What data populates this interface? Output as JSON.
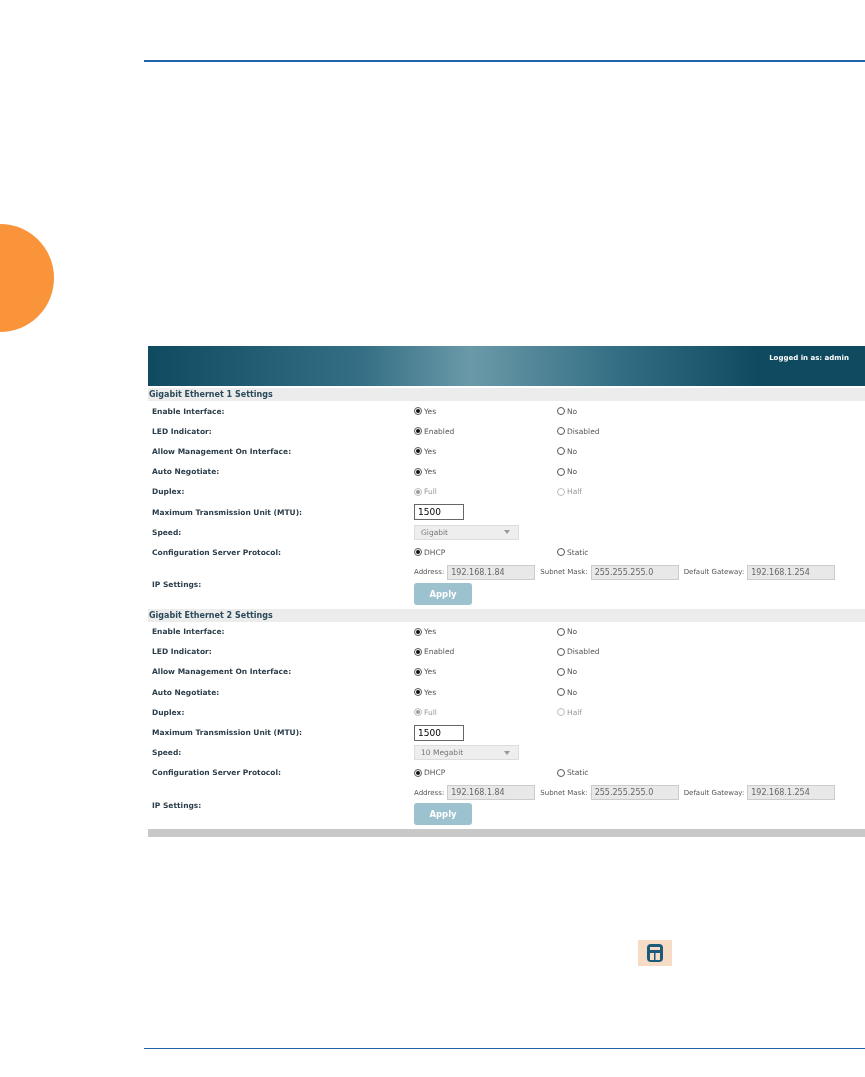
{
  "header": {
    "login_text": "Logged in as: admin"
  },
  "sections": [
    {
      "title": "Gigabit Ethernet 1 Settings",
      "rows": [
        {
          "kind": "radio",
          "label": "Enable Interface:",
          "options": [
            {
              "label": "Yes",
              "selected": true,
              "disabled": false
            },
            {
              "label": "No",
              "selected": false,
              "disabled": false
            }
          ]
        },
        {
          "kind": "radio",
          "label": "LED Indicator:",
          "options": [
            {
              "label": "Enabled",
              "selected": true,
              "disabled": false
            },
            {
              "label": "Disabled",
              "selected": false,
              "disabled": false
            }
          ]
        },
        {
          "kind": "radio",
          "label": "Allow Management On Interface:",
          "options": [
            {
              "label": "Yes",
              "selected": true,
              "disabled": false
            },
            {
              "label": "No",
              "selected": false,
              "disabled": false
            }
          ]
        },
        {
          "kind": "radio",
          "label": "Auto Negotiate:",
          "options": [
            {
              "label": "Yes",
              "selected": true,
              "disabled": false
            },
            {
              "label": "No",
              "selected": false,
              "disabled": false
            }
          ]
        },
        {
          "kind": "radio",
          "label": "Duplex:",
          "options": [
            {
              "label": "Full",
              "selected": true,
              "disabled": true
            },
            {
              "label": "Half",
              "selected": false,
              "disabled": true
            }
          ]
        },
        {
          "kind": "input",
          "label": "Maximum Transmission Unit (MTU):",
          "value": "1500"
        },
        {
          "kind": "select",
          "label": "Speed:",
          "value": "Gigabit"
        },
        {
          "kind": "radio",
          "label": "Configuration Server Protocol:",
          "options": [
            {
              "label": "DHCP",
              "selected": true,
              "disabled": false
            },
            {
              "label": "Static",
              "selected": false,
              "disabled": false
            }
          ]
        },
        {
          "kind": "ip",
          "label": "IP Settings:",
          "fields": [
            {
              "label": "Address:",
              "value": "192.168.1.84"
            },
            {
              "label": "Subnet Mask:",
              "value": "255.255.255.0"
            },
            {
              "label": "Default Gateway:",
              "value": "192.168.1.254"
            }
          ],
          "button": "Apply"
        }
      ]
    },
    {
      "title": "Gigabit Ethernet 2 Settings",
      "rows": [
        {
          "kind": "radio",
          "label": "Enable Interface:",
          "options": [
            {
              "label": "Yes",
              "selected": true,
              "disabled": false
            },
            {
              "label": "No",
              "selected": false,
              "disabled": false
            }
          ]
        },
        {
          "kind": "radio",
          "label": "LED Indicator:",
          "options": [
            {
              "label": "Enabled",
              "selected": true,
              "disabled": false
            },
            {
              "label": "Disabled",
              "selected": false,
              "disabled": false
            }
          ]
        },
        {
          "kind": "radio",
          "label": "Allow Management On Interface:",
          "options": [
            {
              "label": "Yes",
              "selected": true,
              "disabled": false
            },
            {
              "label": "No",
              "selected": false,
              "disabled": false
            }
          ]
        },
        {
          "kind": "radio",
          "label": "Auto Negotiate:",
          "options": [
            {
              "label": "Yes",
              "selected": true,
              "disabled": false
            },
            {
              "label": "No",
              "selected": false,
              "disabled": false
            }
          ]
        },
        {
          "kind": "radio",
          "label": "Duplex:",
          "options": [
            {
              "label": "Full",
              "selected": true,
              "disabled": true
            },
            {
              "label": "Half",
              "selected": false,
              "disabled": true
            }
          ]
        },
        {
          "kind": "input",
          "label": "Maximum Transmission Unit (MTU):",
          "value": "1500"
        },
        {
          "kind": "select",
          "label": "Speed:",
          "value": "10 Megabit"
        },
        {
          "kind": "radio",
          "label": "Configuration Server Protocol:",
          "options": [
            {
              "label": "DHCP",
              "selected": true,
              "disabled": false
            },
            {
              "label": "Static",
              "selected": false,
              "disabled": false
            }
          ]
        },
        {
          "kind": "ip",
          "label": "IP Settings:",
          "fields": [
            {
              "label": "Address:",
              "value": "192.168.1.84"
            },
            {
              "label": "Subnet Mask:",
              "value": "255.255.255.0"
            },
            {
              "label": "Default Gateway:",
              "value": "192.168.1.254"
            }
          ],
          "button": "Apply"
        }
      ]
    }
  ]
}
